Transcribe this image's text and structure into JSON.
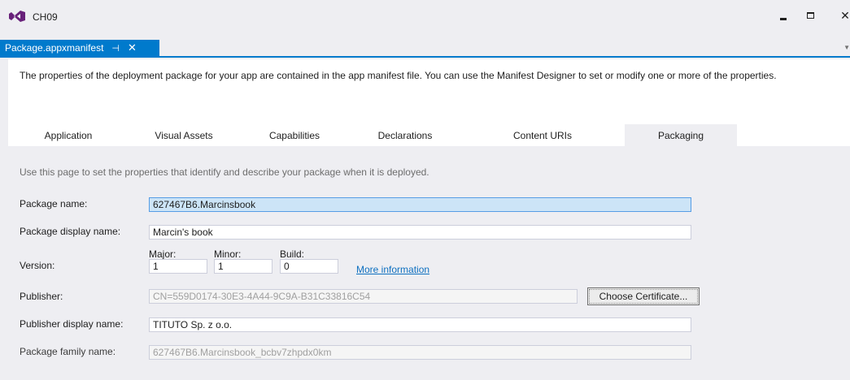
{
  "window": {
    "title": "CH09"
  },
  "document_tab": {
    "label": "Package.appxmanifest",
    "pin_icon": "pin-icon",
    "close_icon": "close-icon"
  },
  "intro_text": "The properties of the deployment package for your app are contained in the app manifest file. You can use the Manifest Designer to set or modify one or more of the properties.",
  "tabs": [
    {
      "label": "Application"
    },
    {
      "label": "Visual Assets"
    },
    {
      "label": "Capabilities"
    },
    {
      "label": "Declarations"
    },
    {
      "label": "Content URIs"
    },
    {
      "label": "Packaging",
      "active": true
    }
  ],
  "packaging": {
    "description": "Use this page to set the properties that identify and describe your package when it is deployed.",
    "package_name": {
      "label": "Package name:",
      "value": "627467B6.Marcinsbook"
    },
    "package_display_name": {
      "label": "Package display name:",
      "value": "Marcin's book"
    },
    "version": {
      "label": "Version:",
      "major": {
        "label": "Major:",
        "value": "1"
      },
      "minor": {
        "label": "Minor:",
        "value": "1"
      },
      "build": {
        "label": "Build:",
        "value": "0"
      },
      "more_info": "More information"
    },
    "publisher": {
      "label": "Publisher:",
      "value": "CN=559D0174-30E3-4A44-9C9A-B31C33816C54",
      "button": "Choose Certificate..."
    },
    "publisher_display_name": {
      "label": "Publisher display name:",
      "value": "TITUTO Sp. z o.o."
    },
    "package_family_name": {
      "label": "Package family name:",
      "value": "627467B6.Marcinsbook_bcbv7zhpdx0km"
    }
  },
  "colors": {
    "accent": "#007acc",
    "link": "#0e70c0",
    "selection": "#cce4f7"
  }
}
